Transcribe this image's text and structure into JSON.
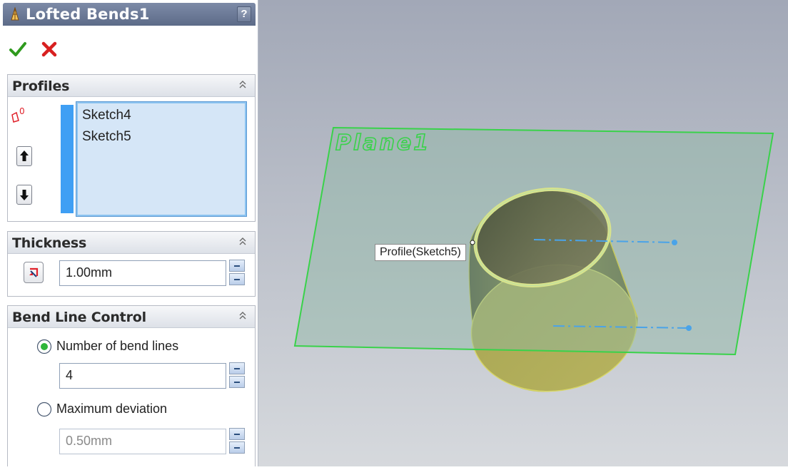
{
  "panel": {
    "title": "Lofted Bends1",
    "help_label": "?",
    "ok_icon": "checkmark-icon",
    "cancel_icon": "x-icon"
  },
  "profiles": {
    "title": "Profiles",
    "items": [
      "Sketch4",
      "Sketch5"
    ],
    "selection_icon": "profile-selection-icon",
    "move_up_icon": "arrow-up-icon",
    "move_down_icon": "arrow-down-icon",
    "accent_color": "#3f9ff4"
  },
  "thickness": {
    "title": "Thickness",
    "value": "1.00mm",
    "direction_icon": "reverse-direction-icon"
  },
  "bend_line_control": {
    "title": "Bend Line Control",
    "option_number": "Number of bend lines",
    "number_value": "4",
    "option_deviation": "Maximum deviation",
    "deviation_value": "0.50mm",
    "selected": "Number of bend lines"
  },
  "viewport": {
    "plane_label": "Plane1",
    "tooltip": "Profile(Sketch5)",
    "plane_color": "#39d24a"
  }
}
